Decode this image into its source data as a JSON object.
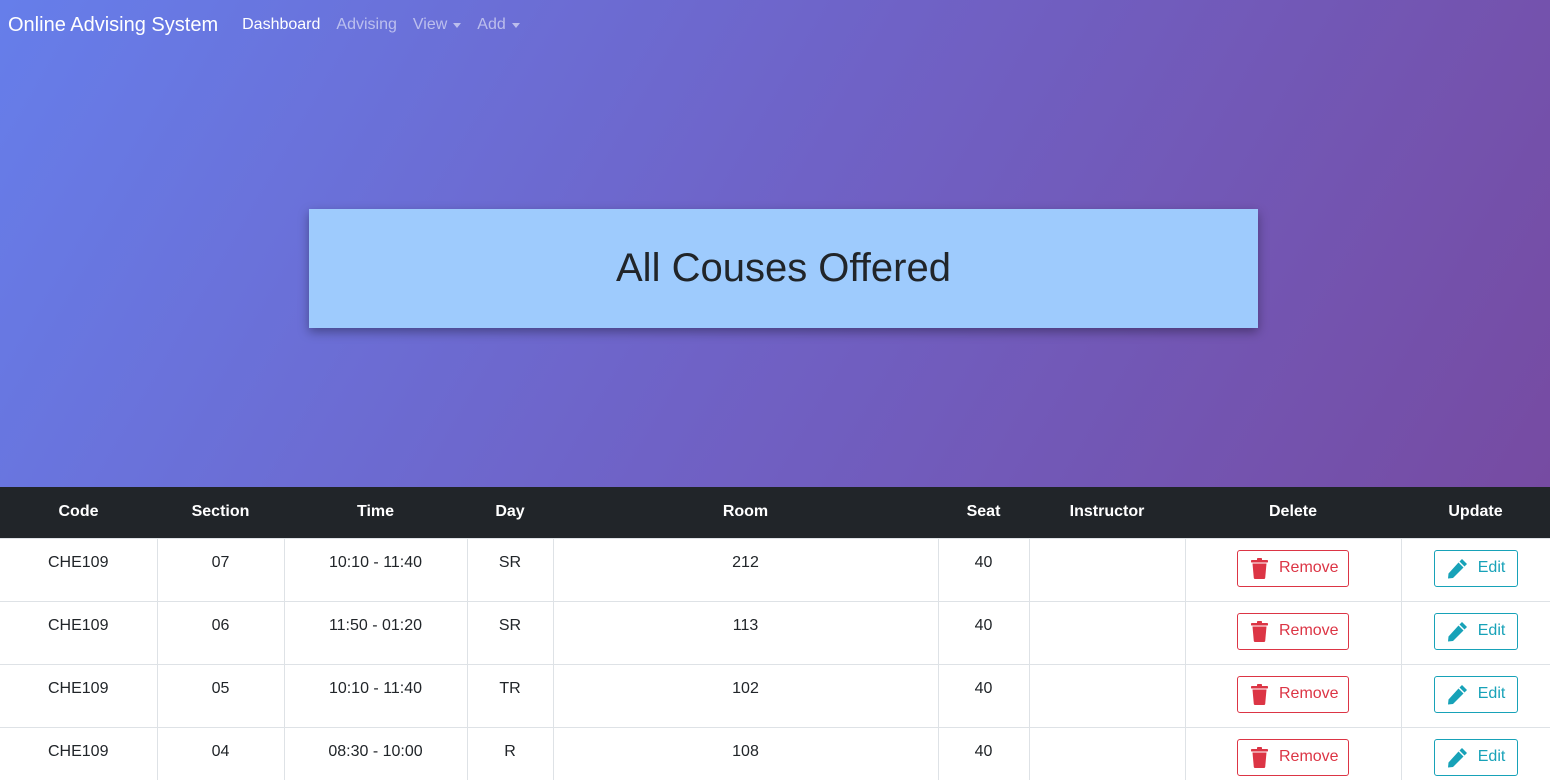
{
  "navbar": {
    "brand": "Online Advising System",
    "items": [
      {
        "label": "Dashboard",
        "active": true,
        "dropdown": false
      },
      {
        "label": "Advising",
        "active": false,
        "dropdown": false
      },
      {
        "label": "View",
        "active": false,
        "dropdown": true
      },
      {
        "label": "Add",
        "active": false,
        "dropdown": true
      }
    ]
  },
  "hero": {
    "title": "All Couses Offered"
  },
  "table": {
    "headers": [
      "Code",
      "Section",
      "Time",
      "Day",
      "Room",
      "Seat",
      "Instructor",
      "Delete",
      "Update"
    ],
    "rows": [
      {
        "code": "CHE109",
        "section": "07",
        "time": "10:10 - 11:40",
        "day": "SR",
        "room": "212",
        "seat": "40",
        "instructor": ""
      },
      {
        "code": "CHE109",
        "section": "06",
        "time": "11:50 - 01:20",
        "day": "SR",
        "room": "113",
        "seat": "40",
        "instructor": ""
      },
      {
        "code": "CHE109",
        "section": "05",
        "time": "10:10 - 11:40",
        "day": "TR",
        "room": "102",
        "seat": "40",
        "instructor": ""
      },
      {
        "code": "CHE109",
        "section": "04",
        "time": "08:30 - 10:00",
        "day": "R",
        "room": "108",
        "seat": "40",
        "instructor": ""
      }
    ],
    "remove_label": "Remove",
    "edit_label": "Edit"
  },
  "colors": {
    "gradient_start": "#667eea",
    "gradient_end": "#764ba2",
    "title_card": "#9ecbfd",
    "table_header": "#212529",
    "danger": "#dc3545",
    "info": "#17a2b8"
  },
  "icons": {
    "remove": "trash-icon",
    "edit": "pencil-icon",
    "dropdown": "caret-down-icon"
  }
}
